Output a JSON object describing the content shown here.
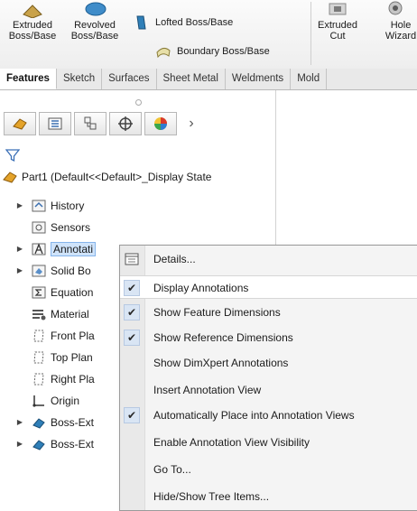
{
  "ribbon": {
    "extruded_boss": "Extruded\nBoss/Base",
    "revolved_boss": "Revolved\nBoss/Base",
    "lofted_boss": "Lofted Boss/Base",
    "boundary_boss": "Boundary Boss/Base",
    "extruded_cut": "Extruded\nCut",
    "hole_wizard": "Hole\nWizard"
  },
  "tabs": [
    "Features",
    "Sketch",
    "Surfaces",
    "Sheet Metal",
    "Weldments",
    "Mold"
  ],
  "active_tab": "Features",
  "tree": {
    "root": "Part1  (Default<<Default>_Display State",
    "items": [
      "History",
      "Sensors",
      "Annotati",
      "Solid Bo",
      "Equation",
      "Material",
      "Front Pla",
      "Top Plan",
      "Right Pla",
      "Origin",
      "Boss-Ext",
      "Boss-Ext"
    ]
  },
  "context_menu": {
    "items": [
      {
        "label": "Details...",
        "checked": false
      },
      {
        "label": "Display Annotations",
        "checked": true
      },
      {
        "label": "Show Feature Dimensions",
        "checked": true
      },
      {
        "label": "Show Reference Dimensions",
        "checked": true
      },
      {
        "label": "Show DimXpert Annotations",
        "checked": false
      },
      {
        "label": "Insert Annotation View",
        "checked": false
      },
      {
        "label": "Automatically Place into Annotation Views",
        "checked": true
      },
      {
        "label": "Enable Annotation View Visibility",
        "checked": false
      },
      {
        "label": "Go To...",
        "checked": false
      },
      {
        "label": "Hide/Show Tree Items...",
        "checked": false
      }
    ]
  },
  "colors": {
    "highlight": "#cfe3fa",
    "check_bg": "#d9e5f4",
    "menu_bg": "#f4f4f4"
  }
}
